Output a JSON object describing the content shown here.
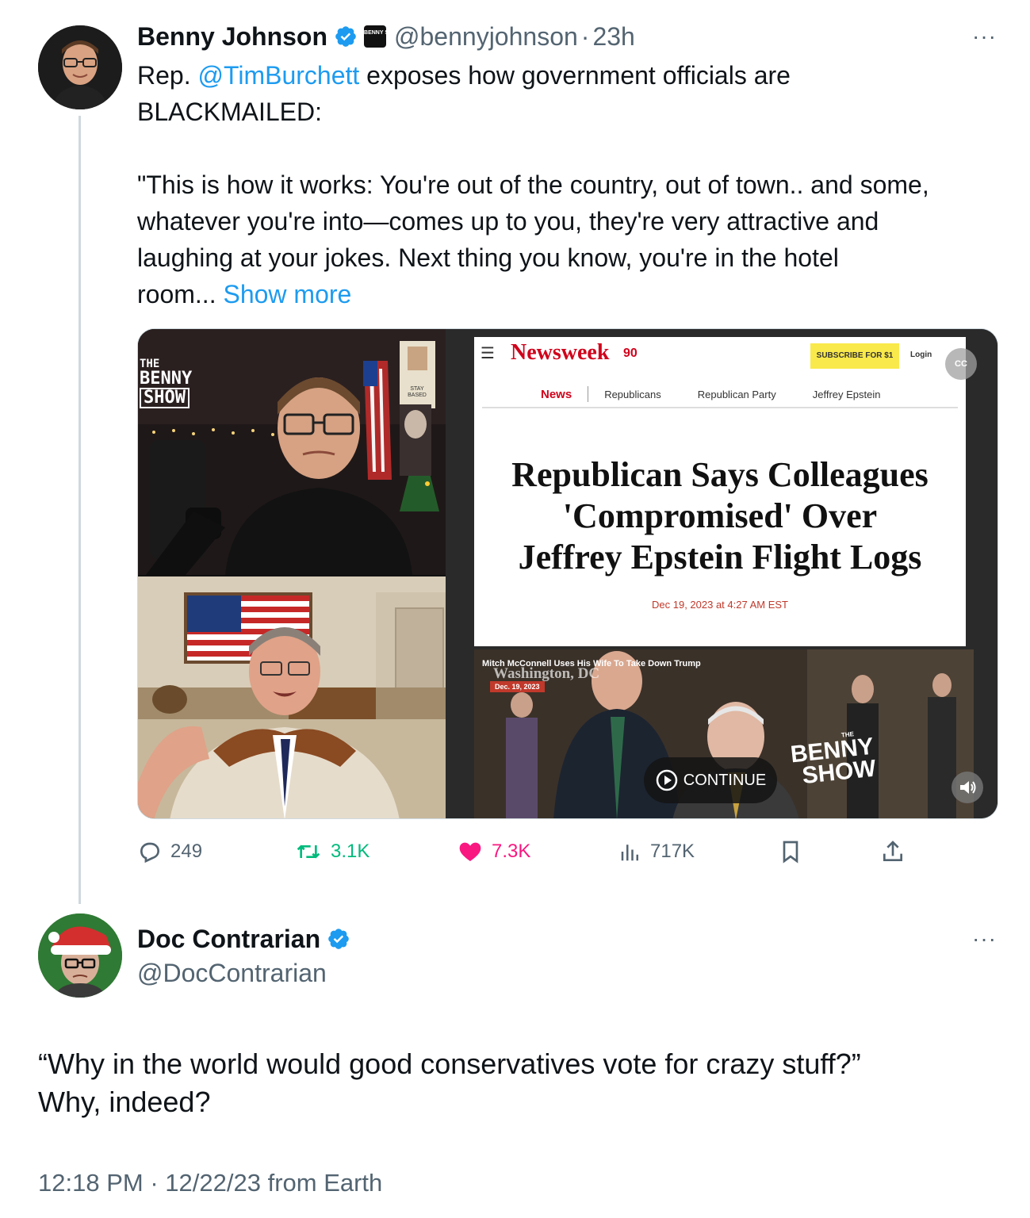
{
  "tweet": {
    "author_name": "Benny Johnson",
    "author_handle": "@bennyjohnson",
    "affiliate_badge": "BENNY SHOW",
    "dot": "·",
    "time_ago": "23h",
    "more_label": "···",
    "text_prefix": "Rep. ",
    "mention": "@TimBurchett",
    "text_line1_rest": " exposes how government officials are",
    "text_line2": "BLACKMAILED:",
    "text_para2_line1": "\"This is how it works: You're out of the country, out of town.. and some,",
    "text_para2_line2": "whatever you're into—comes up to you, they're very attractive and",
    "text_para2_line3": "laughing at your jokes. Next thing you know, you're in the hotel",
    "text_para2_line4": "room... ",
    "show_more": "Show more",
    "video": {
      "host_logo_line1": "THE",
      "host_logo_line2": "BENNY",
      "host_logo_line3": "SHOW",
      "poster_text_line1": "STAY",
      "poster_text_line2": "BASED",
      "site_menu": "☰",
      "site_name": "Newsweek",
      "site_badge": "90",
      "subscribe_label": "SUBSCRIBE FOR $1",
      "login_label": "Login",
      "nav": [
        "News",
        "Republicans",
        "Republican Party",
        "Jeffrey Epstein"
      ],
      "headline_line1": "Republican Says Colleagues",
      "headline_line2": "'Compromised' Over",
      "headline_line3": "Jeffrey Epstein Flight Logs",
      "dateline": "Dec 19, 2023 at 4:27 AM EST",
      "clip_caption": "Mitch McConnell Uses His Wife To Take Down Trump",
      "clip_location": "Washington, DC",
      "clip_date": "Dec. 19, 2023",
      "continue_label": "CONTINUE",
      "watermark_the": "THE",
      "watermark_line1": "BENNY",
      "watermark_line2": "SHOW",
      "cc_label": "CC"
    },
    "stats": {
      "replies": "249",
      "reposts": "3.1K",
      "likes": "7.3K",
      "views": "717K"
    },
    "colors": {
      "link": "#1d9bf0",
      "repost": "#00ba7c",
      "like": "#f91880",
      "muted": "#536471"
    }
  },
  "reply": {
    "author_name": "Doc Contrarian",
    "author_handle": "@DocContrarian",
    "more_label": "···",
    "text_line1": "“Why in the world would good conservatives vote for crazy stuff?”",
    "text_line2": "Why, indeed?",
    "timestamp": "12:18 PM",
    "dot": "·",
    "date": "12/22/23",
    "source": "from Earth"
  }
}
